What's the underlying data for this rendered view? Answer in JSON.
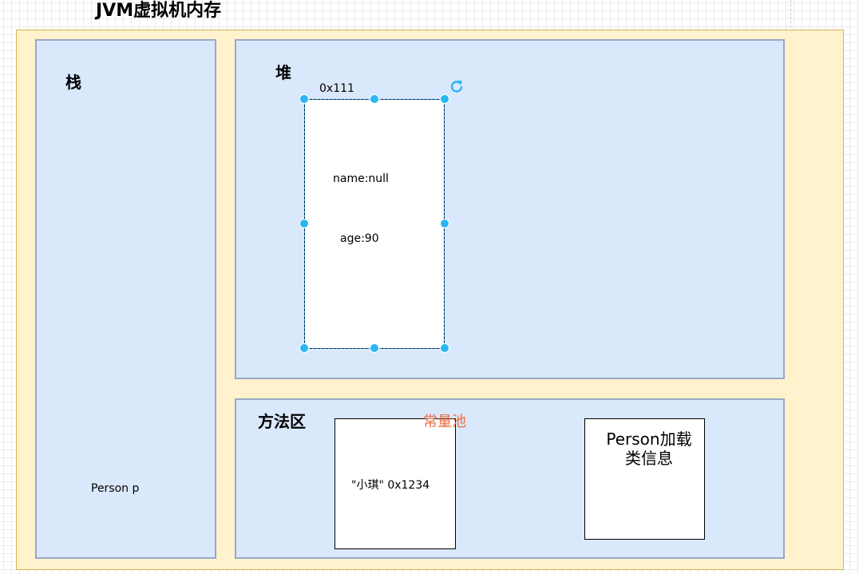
{
  "diagram": {
    "title": "JVM虚拟机内存",
    "stack": {
      "heading": "栈",
      "variable": "Person p"
    },
    "heap": {
      "heading": "堆",
      "object": {
        "address": "0x111",
        "fields": [
          "name:null",
          "age:90"
        ]
      }
    },
    "method_area": {
      "heading": "方法区",
      "constant_pool": {
        "label": "常量池",
        "entry": "\"小琪\" 0x1234"
      },
      "class_info": {
        "line1": "Person加载",
        "line2": "类信息"
      }
    }
  },
  "colors": {
    "outer_fill": "#fff2cc",
    "outer_border": "#d6b656",
    "panel_fill": "#dae8fc",
    "panel_border": "#97a9c7",
    "selection": "#29b6f2",
    "pool_label": "#ea6b3e"
  },
  "icons": [
    "rotate-icon"
  ]
}
